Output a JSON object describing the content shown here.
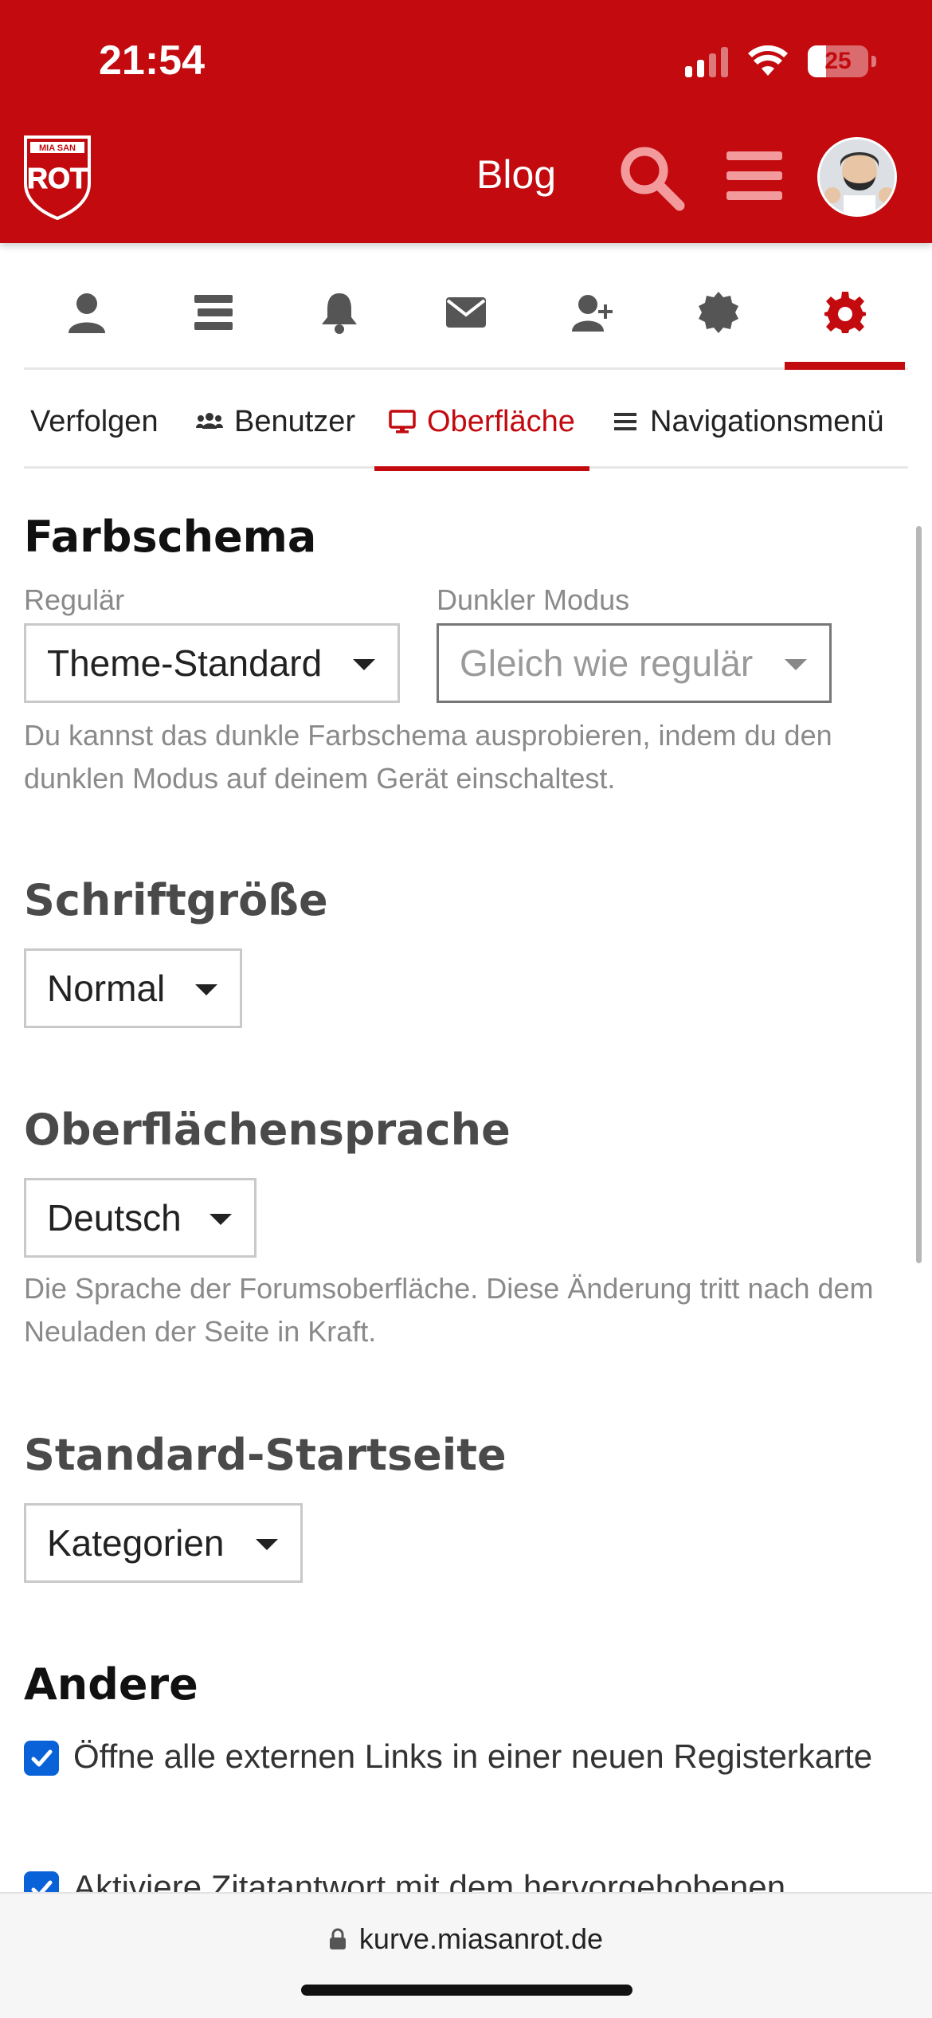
{
  "status_bar": {
    "time": "21:54",
    "battery": "25"
  },
  "header": {
    "logo_text": "MIA SAN ROT",
    "blog_label": "Blog",
    "brand_color": "#c20a0f"
  },
  "icon_nav": [
    {
      "icon": "user-icon"
    },
    {
      "icon": "stream-icon"
    },
    {
      "icon": "bell-icon"
    },
    {
      "icon": "envelope-icon"
    },
    {
      "icon": "user-plus-icon"
    },
    {
      "icon": "badge-icon"
    },
    {
      "icon": "gear-icon",
      "active": true
    }
  ],
  "sub_tabs": {
    "follow": "Verfolgen",
    "users": "Benutzer",
    "interface": "Oberfläche",
    "nav_menu": "Navigationsmenü"
  },
  "color_scheme": {
    "title": "Farbschema",
    "regular_label": "Regulär",
    "regular_value": "Theme-Standard",
    "dark_label": "Dunkler Modus",
    "dark_value": "Gleich wie regulär",
    "help": "Du kannst das dunkle Farbschema ausprobieren, indem du den dunklen Modus auf deinem Gerät einschaltest."
  },
  "font_size": {
    "title": "Schriftgröße",
    "value": "Normal"
  },
  "interface_language": {
    "title": "Oberflächensprache",
    "value": "Deutsch",
    "help": "Die Sprache der Forumsoberfläche. Diese Änderung tritt nach dem Neuladen der Seite in Kraft."
  },
  "default_homepage": {
    "title": "Standard-Startseite",
    "value": "Kategorien"
  },
  "other": {
    "title": "Andere",
    "options": [
      {
        "label": "Öffne alle externen Links in einer neuen Registerkarte",
        "checked": true
      },
      {
        "label": "Aktiviere Zitatantwort mit dem hervorgehobenen",
        "checked": true
      }
    ]
  },
  "browser": {
    "url": "kurve.miasanrot.de"
  }
}
